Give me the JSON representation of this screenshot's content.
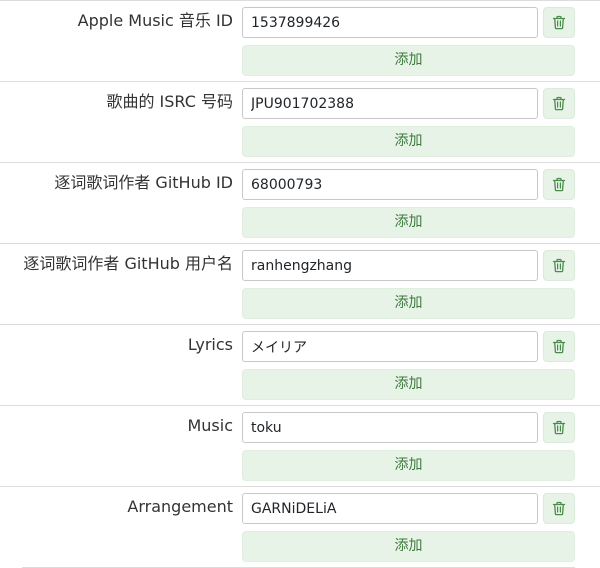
{
  "fields": [
    {
      "label": "Apple Music 音乐 ID",
      "value": "1537899426",
      "add_label": "添加"
    },
    {
      "label": "歌曲的 ISRC 号码",
      "value": "JPU901702388",
      "add_label": "添加"
    },
    {
      "label": "逐词歌词作者 GitHub ID",
      "value": "68000793",
      "add_label": "添加"
    },
    {
      "label": "逐词歌词作者 GitHub 用户名",
      "value": "ranhengzhang",
      "add_label": "添加"
    },
    {
      "label": "Lyrics",
      "value": "メイリア",
      "add_label": "添加"
    },
    {
      "label": "Music",
      "value": "toku",
      "add_label": "添加"
    },
    {
      "label": "Arrangement",
      "value": "GARNiDELiA",
      "add_label": "添加"
    }
  ],
  "icons": {
    "delete": "trash-icon"
  },
  "colors": {
    "accent_bg": "#e8f3e8",
    "accent_text": "#3d7a3d",
    "divider": "#dcdcdc"
  }
}
